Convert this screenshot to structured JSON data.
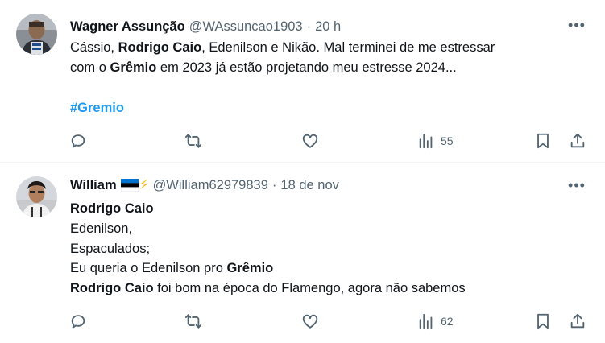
{
  "tweets": [
    {
      "author_name": "Wagner Assunção",
      "handle": "@WAssuncao1903",
      "separator": "·",
      "time": "20 h",
      "more_label": "•••",
      "lines": [
        [
          "Cássio, ",
          "Rodrigo Caio",
          ", Edenilson e Nikão. Mal terminei de me estressar"
        ],
        [
          "com o ",
          "Grêmio",
          " em 2023 já estão projetando meu estresse 2024..."
        ]
      ],
      "hashtag": "#Gremio",
      "views": "55"
    },
    {
      "author_name": "William",
      "handle": "@William62979839",
      "separator": "·",
      "time": "18 de nov",
      "more_label": "•••",
      "flag_colors": [
        "#0072ce",
        "#000000",
        "#ffffff"
      ],
      "lightning": "⚡",
      "line1": "Rodrigo Caio",
      "line2": "Edenilson,",
      "line3": "Espaculados;",
      "line4_pre": "Eu queria o Edenilson pro ",
      "line4_bold": "Grêmio",
      "line5_bold": "Rodrigo Caio",
      "line5_post": " foi bom na época do Flamengo, agora não sabemos",
      "views": "62"
    }
  ]
}
